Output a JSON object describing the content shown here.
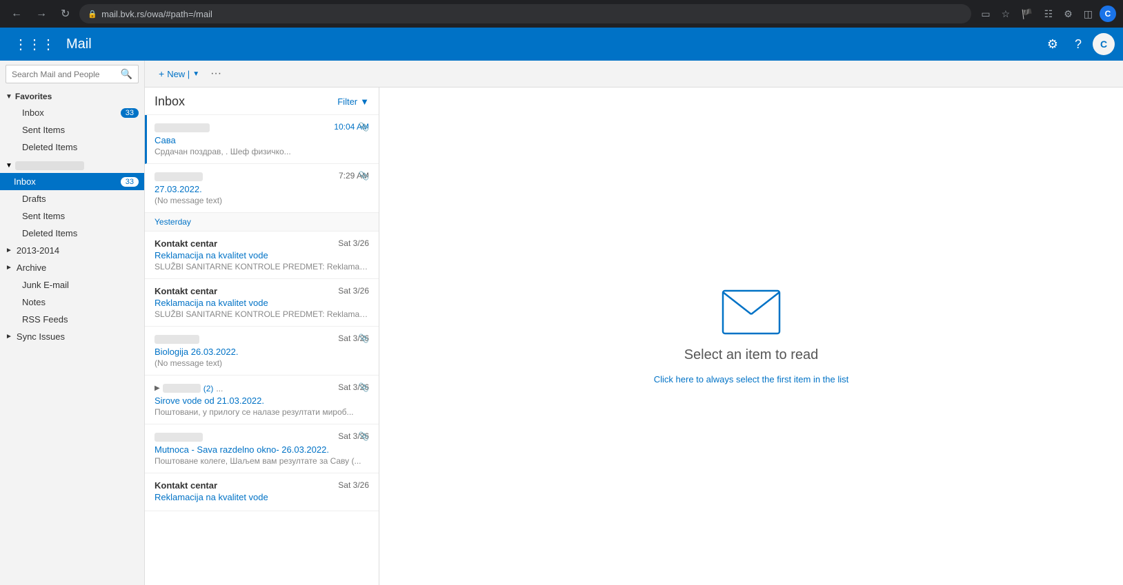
{
  "browser": {
    "url": "mail.bvk.rs/owa/#path=/mail",
    "back_title": "Back",
    "forward_title": "Forward",
    "reload_title": "Reload",
    "user_initial": "C"
  },
  "appbar": {
    "title": "Mail",
    "settings_label": "Settings",
    "help_label": "Help"
  },
  "search": {
    "placeholder": "Search Mail and People"
  },
  "toolbar": {
    "new_label": "New |",
    "more_label": "···"
  },
  "sidebar": {
    "favorites_label": "Favorites",
    "favorites_items": [
      {
        "name": "Inbox",
        "badge": "33"
      },
      {
        "name": "Sent Items",
        "badge": ""
      },
      {
        "name": "Deleted Items",
        "badge": ""
      }
    ],
    "account_name": "",
    "folders": [
      {
        "name": "Inbox",
        "badge": "33",
        "active": true
      },
      {
        "name": "Drafts",
        "badge": "",
        "active": false
      },
      {
        "name": "Sent Items",
        "badge": "",
        "active": false
      },
      {
        "name": "Deleted Items",
        "badge": "",
        "active": false
      }
    ],
    "subgroups": [
      {
        "name": "2013-2014",
        "collapsed": true
      },
      {
        "name": "Archive",
        "collapsed": true
      }
    ],
    "extra_folders": [
      {
        "name": "Junk E-mail"
      },
      {
        "name": "Notes"
      },
      {
        "name": "RSS Feeds"
      }
    ],
    "sync_issues": {
      "name": "Sync Issues",
      "collapsed": true
    }
  },
  "email_list": {
    "title": "Inbox",
    "filter_label": "Filter",
    "emails": [
      {
        "id": 1,
        "sender_blurred": true,
        "sender_width": 80,
        "time": "10:04 AM",
        "subject": "Сава",
        "preview": "Срдачан поздрав,  .  Шеф физичко...",
        "has_attachment": true,
        "unread": true,
        "selected": true
      },
      {
        "id": 2,
        "sender_blurred": true,
        "sender_width": 70,
        "time": "7:29 AM",
        "subject": "27.03.2022.",
        "preview": "(No message text)",
        "has_attachment": true,
        "unread": false,
        "selected": false
      }
    ],
    "date_separator": "Yesterday",
    "yesterday_emails": [
      {
        "id": 3,
        "sender": "Kontakt centar",
        "time": "Sat 3/26",
        "subject": "Reklamacija na kvalitet vode",
        "preview": "SLUŽBI SANITARNE KONTROLE PREDMET: Reklamacij...",
        "has_attachment": false,
        "unread": false
      },
      {
        "id": 4,
        "sender": "Kontakt centar",
        "time": "Sat 3/26",
        "subject": "Reklamacija na kvalitet vode",
        "preview": "SLUŽBI SANITARNE KONTROLE PREDMET: Reklamacij...",
        "has_attachment": false,
        "unread": false
      },
      {
        "id": 5,
        "sender_blurred": true,
        "sender_width": 65,
        "time": "Sat 3/26",
        "subject": "Biologija 26.03.2022.",
        "preview": "(No message text)",
        "has_attachment": true,
        "unread": false
      },
      {
        "id": 6,
        "sender_blurred": true,
        "sender_width": 55,
        "time": "Sat 3/26",
        "subject": "Sirove vode od 21.03.2022.",
        "thread_count": "(2)",
        "preview": "Поштовани, у прилогу се налазе резултати мироб...",
        "has_attachment": true,
        "unread": false,
        "expandable": true,
        "more_dots": true
      },
      {
        "id": 7,
        "sender_blurred": true,
        "sender_width": 70,
        "time": "Sat 3/26",
        "subject": "Mutnoca - Sava razdelno okno- 26.03.2022.",
        "preview": "Поштоване колеге, Шаљем вам резултате за Саву (...",
        "has_attachment": true,
        "unread": false
      },
      {
        "id": 8,
        "sender": "Kontakt centar",
        "time": "Sat 3/26",
        "subject": "Reklamacija na kvalitet vode",
        "preview": "",
        "has_attachment": false,
        "unread": false
      }
    ]
  },
  "reading_pane": {
    "title": "Select an item to read",
    "link_text": "Click here to always select the first item in the list"
  }
}
